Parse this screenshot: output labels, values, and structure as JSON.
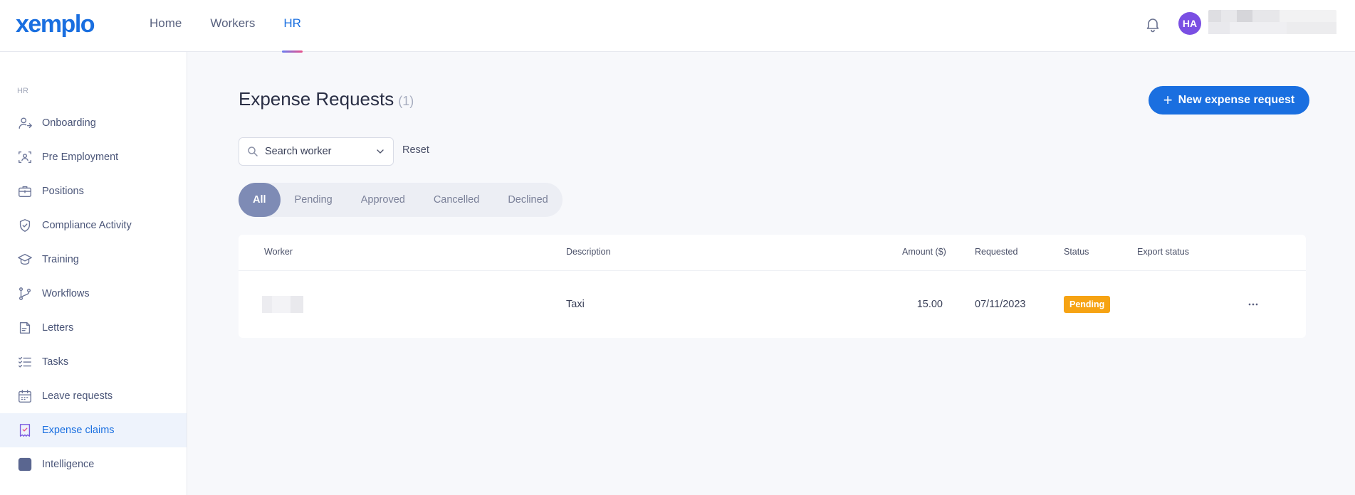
{
  "app": {
    "logo": "xemplo",
    "nav": [
      {
        "label": "Home"
      },
      {
        "label": "Workers"
      },
      {
        "label": "HR"
      }
    ],
    "active_nav": "HR",
    "user_initials": "HA",
    "avatar_color": "#7a4fe3",
    "accent_color": "#1a6fe0"
  },
  "sidebar": {
    "section": "HR",
    "items": [
      {
        "label": "Onboarding",
        "icon": "user-arrow-icon"
      },
      {
        "label": "Pre Employment",
        "icon": "user-scan-icon"
      },
      {
        "label": "Positions",
        "icon": "briefcase-icon"
      },
      {
        "label": "Compliance Activity",
        "icon": "shield-check-icon"
      },
      {
        "label": "Training",
        "icon": "graduation-cap-icon"
      },
      {
        "label": "Workflows",
        "icon": "git-branch-icon"
      },
      {
        "label": "Letters",
        "icon": "document-icon"
      },
      {
        "label": "Tasks",
        "icon": "checklist-icon"
      },
      {
        "label": "Leave requests",
        "icon": "calendar-icon"
      },
      {
        "label": "Expense claims",
        "icon": "receipt-icon"
      },
      {
        "label": "Intelligence",
        "icon": "square-icon"
      }
    ],
    "active_item": "Expense claims"
  },
  "main": {
    "title": "Expense Requests",
    "count": "(1)",
    "new_button": "New expense request",
    "search_placeholder": "Search worker",
    "reset": "Reset",
    "tabs": [
      {
        "label": "All"
      },
      {
        "label": "Pending"
      },
      {
        "label": "Approved"
      },
      {
        "label": "Cancelled"
      },
      {
        "label": "Declined"
      }
    ],
    "active_tab": "All",
    "table": {
      "columns": {
        "worker": "Worker",
        "description": "Description",
        "amount": "Amount ($)",
        "requested": "Requested",
        "status": "Status",
        "export_status": "Export status"
      },
      "rows": [
        {
          "worker": "",
          "description": "Taxi",
          "amount": "15.00",
          "requested": "07/11/2023",
          "status": "Pending",
          "status_color": "#f6a313",
          "export_status": ""
        }
      ]
    }
  }
}
